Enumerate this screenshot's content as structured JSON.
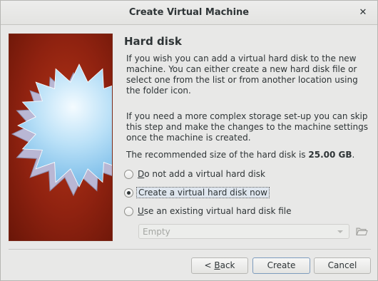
{
  "window": {
    "title": "Create Virtual Machine",
    "close_glyph": "✕"
  },
  "page": {
    "heading": "Hard disk",
    "paragraph1": "If you wish you can add a virtual hard disk to the new machine. You can either create a new hard disk file or select one from the list or from another location using the folder icon.",
    "paragraph2": "If you need a more complex storage set-up you can skip this step and make the changes to the machine settings once the machine is created.",
    "recommended_prefix": "The recommended size of the hard disk is ",
    "recommended_size": "25.00 GB",
    "recommended_suffix": "."
  },
  "options": [
    {
      "mnemonic": "D",
      "rest": "o not add a virtual hard disk",
      "checked": false
    },
    {
      "mnemonic": "",
      "rest": "Create a virtual hard disk now",
      "checked": true
    },
    {
      "mnemonic": "U",
      "rest": "se an existing virtual hard disk file",
      "checked": false
    }
  ],
  "disk_combo": {
    "value": "Empty",
    "enabled": false
  },
  "buttons": {
    "back_prefix": "< ",
    "back_mnemonic": "B",
    "back_rest": "ack",
    "create": "Create",
    "cancel": "Cancel"
  },
  "icons": {
    "side_image": "virtualbox-starburst-icon",
    "folder": "folder-open-icon",
    "close": "close-icon"
  },
  "colors": {
    "side_bg": "#8f2210",
    "star_light": "#eaf6ff",
    "star_mid": "#8cc8ee",
    "star_edge": "#b8bcd8"
  }
}
